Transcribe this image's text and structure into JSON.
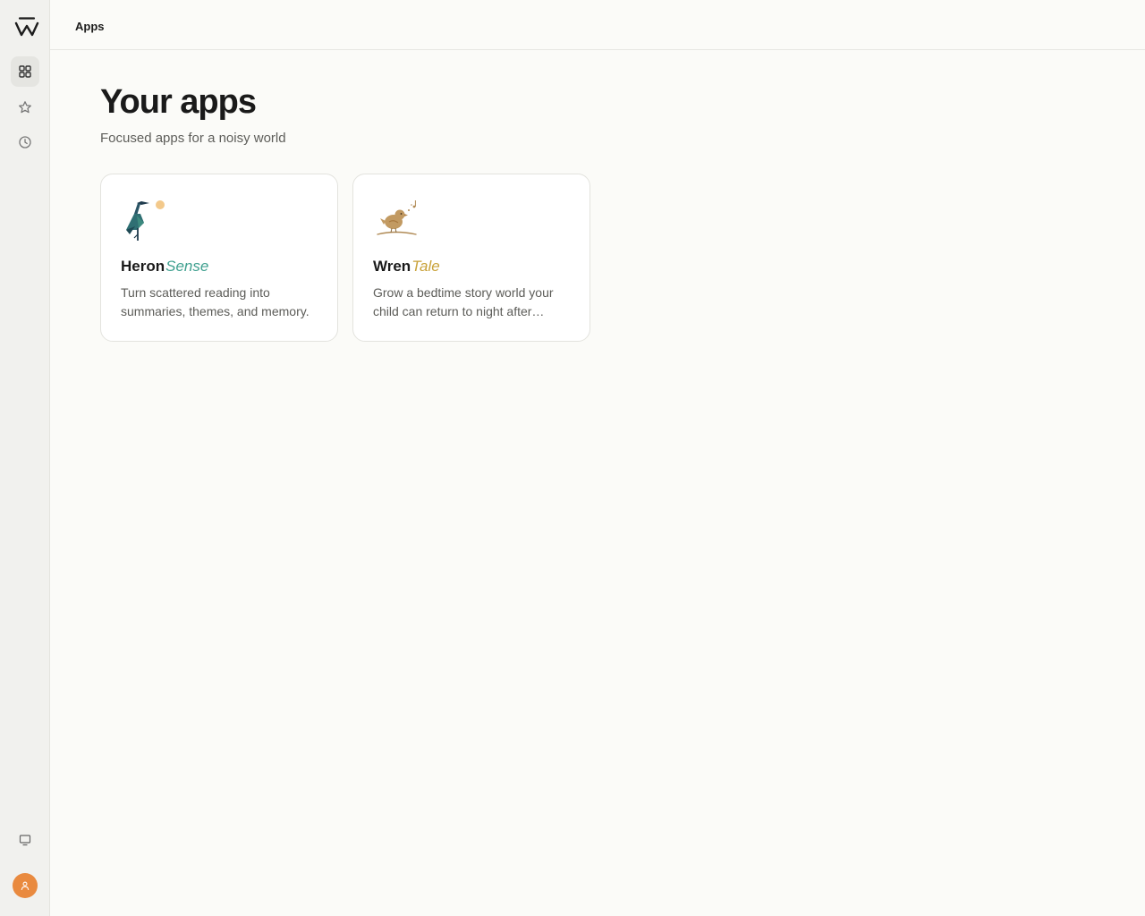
{
  "topbar": {
    "title": "Apps"
  },
  "sidebar": {
    "logo": "logo-icon",
    "items": [
      {
        "icon": "apps-grid-icon",
        "active": true
      },
      {
        "icon": "star-icon",
        "active": false
      },
      {
        "icon": "clock-icon",
        "active": false
      }
    ],
    "bottom": [
      {
        "icon": "monitor-icon"
      },
      {
        "icon": "user-avatar-icon"
      }
    ]
  },
  "main": {
    "title": "Your apps",
    "subtitle": "Focused apps for a noisy world",
    "apps": [
      {
        "name_a": "Heron",
        "name_b": "Sense",
        "accent": "#3fa08f",
        "icon": "heron-icon",
        "description": "Turn scattered reading into summaries, themes, and memory."
      },
      {
        "name_a": "Wren",
        "name_b": "Tale",
        "accent": "#c9a23a",
        "icon": "wren-icon",
        "description": "Grow a bedtime story world your child can return to night after…"
      }
    ]
  },
  "colors": {
    "avatar": "#e98a3f",
    "background": "#fbfbf8",
    "sidebar": "#f1f1ee"
  }
}
